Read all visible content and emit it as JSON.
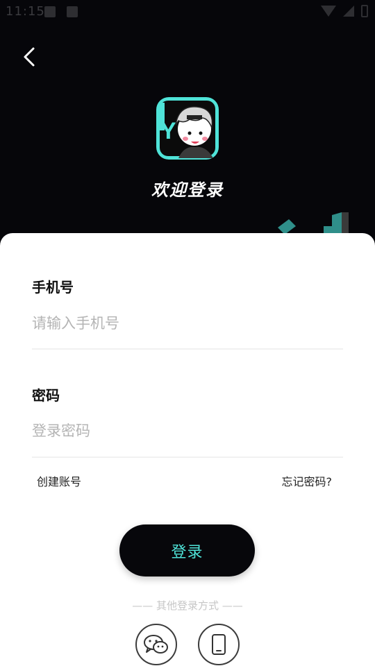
{
  "status_bar": {
    "time": "11:15",
    "icons": [
      "notification-icon",
      "notification-icon",
      "wifi-icon",
      "cellular-icon",
      "battery-icon"
    ]
  },
  "header": {
    "back_icon": "back-arrow-icon",
    "logo_letters": "HY",
    "welcome": "欢迎登录"
  },
  "form": {
    "phone": {
      "label": "手机号",
      "placeholder": "请输入手机号",
      "value": ""
    },
    "password": {
      "label": "密码",
      "placeholder": "登录密码",
      "value": ""
    },
    "create_account": "创建账号",
    "forgot_password": "忘记密码?",
    "login_button": "登录"
  },
  "other_login": {
    "label": "—— 其他登录方式 ——",
    "methods": [
      {
        "name": "wechat",
        "icon": "wechat-icon"
      },
      {
        "name": "phone",
        "icon": "phone-icon"
      }
    ]
  },
  "colors": {
    "background": "#06060a",
    "accent": "#4fe3d8",
    "card": "#ffffff",
    "button": "#07070b"
  }
}
